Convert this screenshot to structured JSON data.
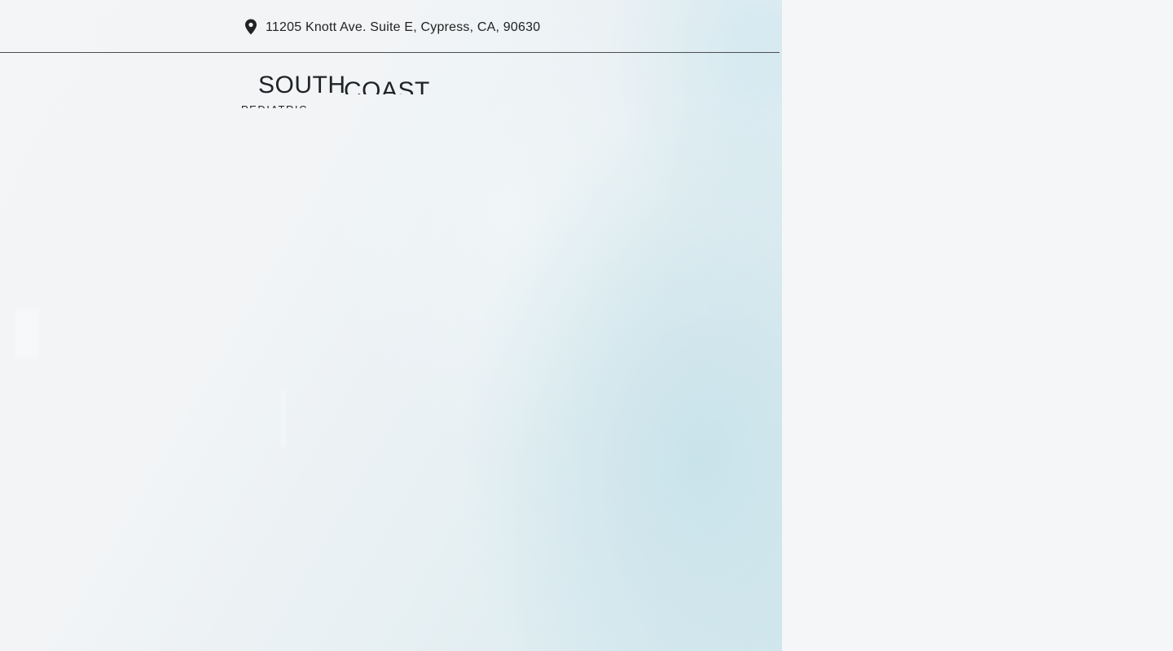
{
  "topbar": {
    "address": "11205 Knott Ave. Suite E, Cypress, CA, 90630",
    "icon": "map-pin-icon"
  },
  "logo": {
    "word1": "SOUTH",
    "word2": "COAST",
    "word3": "PEDIATRIC"
  },
  "colors": {
    "text": "#222222",
    "divider": "#4a4d50",
    "accent_tint": "#d6e9ef",
    "background": "#f5f6f8"
  }
}
